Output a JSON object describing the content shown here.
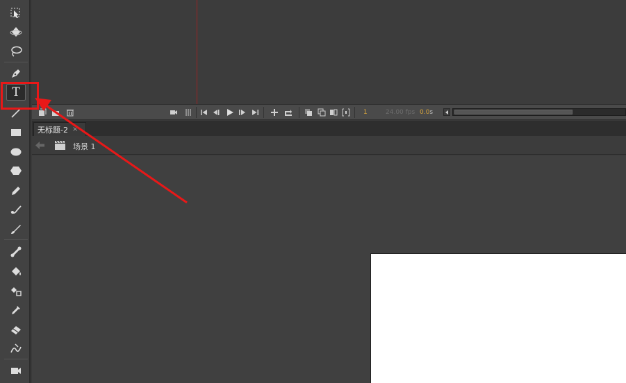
{
  "toolbar": {
    "tools": [
      {
        "name": "subselection-tool-icon"
      },
      {
        "name": "3d-rotation-tool-icon"
      },
      {
        "name": "lasso-tool-icon"
      },
      {
        "name": "pen-tool-icon"
      },
      {
        "name": "text-tool-icon",
        "glyph": "T",
        "active": true
      },
      {
        "name": "line-tool-icon"
      },
      {
        "name": "rectangle-tool-icon"
      },
      {
        "name": "oval-tool-icon"
      },
      {
        "name": "polystar-tool-icon"
      },
      {
        "name": "pencil-tool-icon"
      },
      {
        "name": "paint-brush-tool-icon"
      },
      {
        "name": "brush-tool-icon"
      },
      {
        "name": "bone-tool-icon"
      },
      {
        "name": "paint-bucket-tool-icon"
      },
      {
        "name": "ink-bottle-tool-icon"
      },
      {
        "name": "eyedropper-tool-icon"
      },
      {
        "name": "eraser-tool-icon"
      },
      {
        "name": "width-tool-icon"
      },
      {
        "name": "camera-tool-icon"
      }
    ]
  },
  "timeline": {
    "current_frame": "1",
    "fps": "24.00 fps",
    "elapsed": "0.0",
    "elapsed_unit": "s"
  },
  "document": {
    "tab_title": "无标题-2",
    "close_glyph": "×"
  },
  "editbar": {
    "scene_label": "场景 1"
  },
  "colors": {
    "panel_bg": "#3a3a3a",
    "stage": "#ffffff",
    "playhead": "#9b2323",
    "annotation": "#e81818",
    "frame_accent": "#d4a23c"
  }
}
